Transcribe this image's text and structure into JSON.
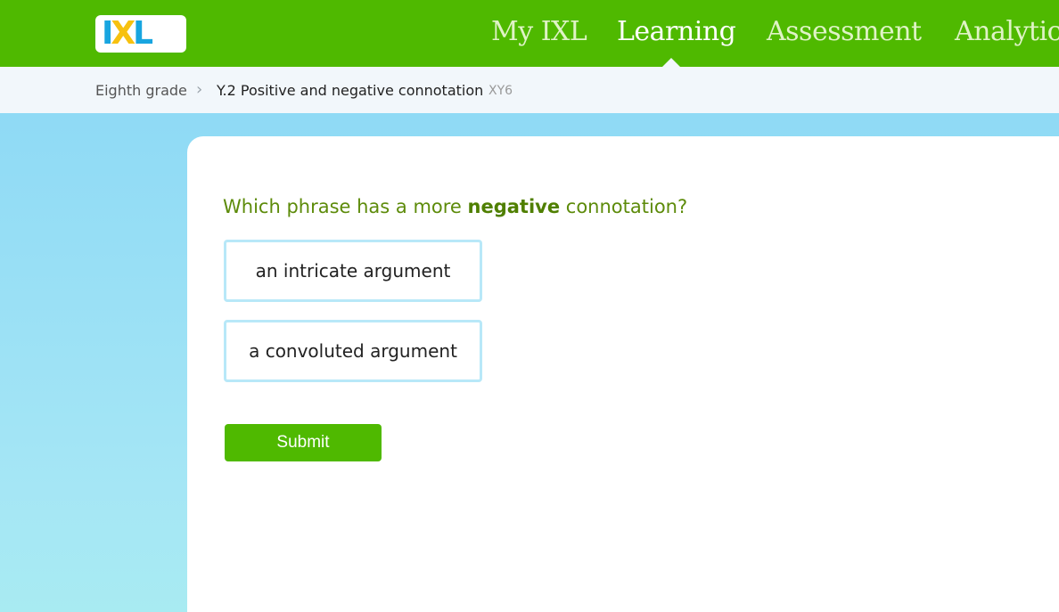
{
  "header": {
    "logo_text": [
      "I",
      "X",
      "L"
    ],
    "nav": {
      "my_ixl": "My IXL",
      "learning": "Learning",
      "assessment": "Assessment",
      "analytics": "Analytics"
    },
    "active_tab": "Learning",
    "brand_color": "#4fb900"
  },
  "breadcrumb": {
    "grade": "Eighth grade",
    "separator_icon": "chevron-right-icon",
    "skill": "Y.2 Positive and negative connotation",
    "skill_code": "XY6"
  },
  "question": {
    "prefix": "Which phrase has a more ",
    "emphasis": "negative",
    "suffix": " connotation?"
  },
  "choices": [
    {
      "label": "an intricate argument"
    },
    {
      "label": "a convoluted argument"
    }
  ],
  "submit_label": "Submit"
}
